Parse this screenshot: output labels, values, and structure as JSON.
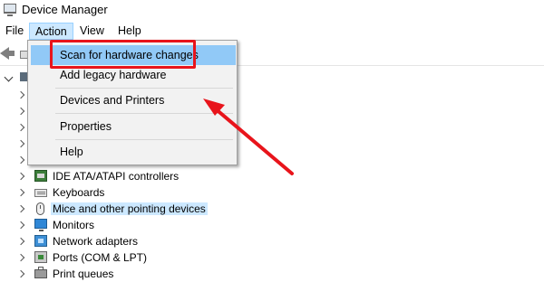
{
  "window": {
    "title": "Device Manager"
  },
  "menubar": {
    "file": "File",
    "action": "Action",
    "view": "View",
    "help": "Help"
  },
  "dropdown": {
    "items": [
      {
        "label": "Scan for hardware changes"
      },
      {
        "label": "Add legacy hardware"
      },
      {
        "label": "Devices and Printers"
      },
      {
        "label": "Properties"
      },
      {
        "label": "Help"
      }
    ]
  },
  "tree": {
    "items": [
      {
        "label": "IDE ATA/ATAPI controllers",
        "icon": "ide-controller-icon"
      },
      {
        "label": "Keyboards",
        "icon": "keyboard-icon"
      },
      {
        "label": "Mice and other pointing devices",
        "icon": "mouse-icon",
        "selected": true
      },
      {
        "label": "Monitors",
        "icon": "monitor-icon"
      },
      {
        "label": "Network adapters",
        "icon": "network-adapter-icon"
      },
      {
        "label": "Ports (COM & LPT)",
        "icon": "port-icon"
      },
      {
        "label": "Print queues",
        "icon": "printer-icon"
      }
    ]
  },
  "annotation": {
    "highlight_color": "#e8141b",
    "arrow_color": "#e8141b"
  },
  "colors": {
    "menu_active": "#cce8ff",
    "dropdown_hover": "#91c9f7",
    "selection": "#cce8ff"
  }
}
